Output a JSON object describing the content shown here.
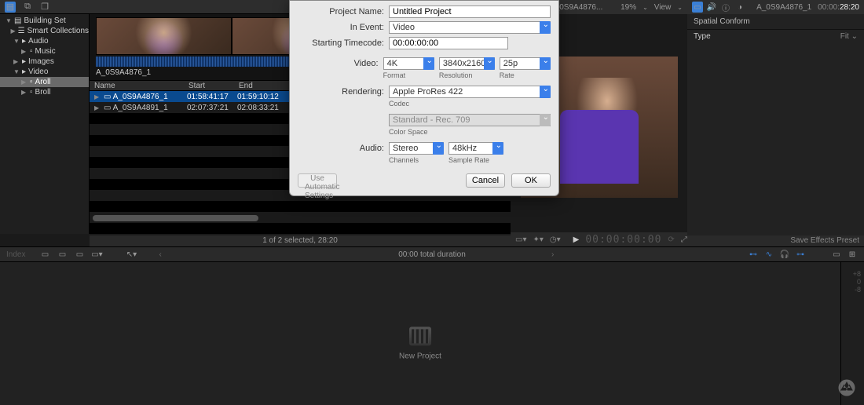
{
  "top_toolbar": {
    "back_icon": "←",
    "media_icon": "◧",
    "clip_icon": "❐"
  },
  "sidebar": {
    "items": [
      {
        "label": "Building Set",
        "depth": 0,
        "icon": "▤",
        "open": true
      },
      {
        "label": "Smart Collections",
        "depth": 1,
        "icon": "☰",
        "open": false
      },
      {
        "label": "Audio",
        "depth": 1,
        "icon": "▸",
        "open": true
      },
      {
        "label": "Music",
        "depth": 2,
        "icon": "",
        "open": false
      },
      {
        "label": "Images",
        "depth": 1,
        "icon": "▸",
        "open": false
      },
      {
        "label": "Video",
        "depth": 1,
        "icon": "▸",
        "open": true
      },
      {
        "label": "Aroll",
        "depth": 2,
        "icon": "",
        "open": false,
        "selected": true
      },
      {
        "label": "Broll",
        "depth": 2,
        "icon": "",
        "open": false
      }
    ]
  },
  "browser": {
    "clip_label": "A_0S9A4876_1",
    "columns": {
      "name": "Name",
      "start": "Start",
      "end": "End"
    },
    "rows": [
      {
        "name": "A_0S9A4876_1",
        "start": "01:58:41:17",
        "end": "01:59:10:12",
        "selected": true
      },
      {
        "name": "A_0S9A4891_1",
        "start": "02:07:37:21",
        "end": "02:08:33:21",
        "selected": false
      }
    ],
    "footer": "1 of 2 selected, 28:20"
  },
  "viewer_header": {
    "clip_name": "A_0S9A4876...",
    "zoom": "19%",
    "view_label": "View"
  },
  "viewer_toolbar": {
    "timecode": "00:00:00:00"
  },
  "inspector_header": {
    "clip": "A_0S9A4876_1",
    "tc_gray": "00:00:",
    "tc_white": "28:20"
  },
  "inspector": {
    "section": "Spatial Conform",
    "type_label": "Type",
    "type_value": "Fit",
    "footer": "Save Effects Preset"
  },
  "timeline_bar": {
    "index": "Index",
    "center": "00:00 total duration"
  },
  "timeline_body": {
    "new_project": "New Project",
    "ruler": [
      "+8",
      "0",
      "-8"
    ]
  },
  "modal": {
    "labels": {
      "project_name": "Project Name:",
      "in_event": "In Event:",
      "starting_tc": "Starting Timecode:",
      "video": "Video:",
      "rendering": "Rendering:",
      "audio": "Audio:"
    },
    "sublabels": {
      "format": "Format",
      "resolution": "Resolution",
      "rate": "Rate",
      "codec": "Codec",
      "color_space": "Color Space",
      "channels": "Channels",
      "sample_rate": "Sample Rate"
    },
    "values": {
      "project_name": "Untitled Project",
      "in_event": "Video",
      "starting_tc": "00:00:00:00",
      "format": "4K",
      "resolution": "3840x2160",
      "rate": "25p",
      "codec": "Apple ProRes 422",
      "color_space": "Standard - Rec. 709",
      "channels": "Stereo",
      "sample_rate": "48kHz"
    },
    "buttons": {
      "auto": "Use Automatic Settings",
      "cancel": "Cancel",
      "ok": "OK"
    }
  }
}
